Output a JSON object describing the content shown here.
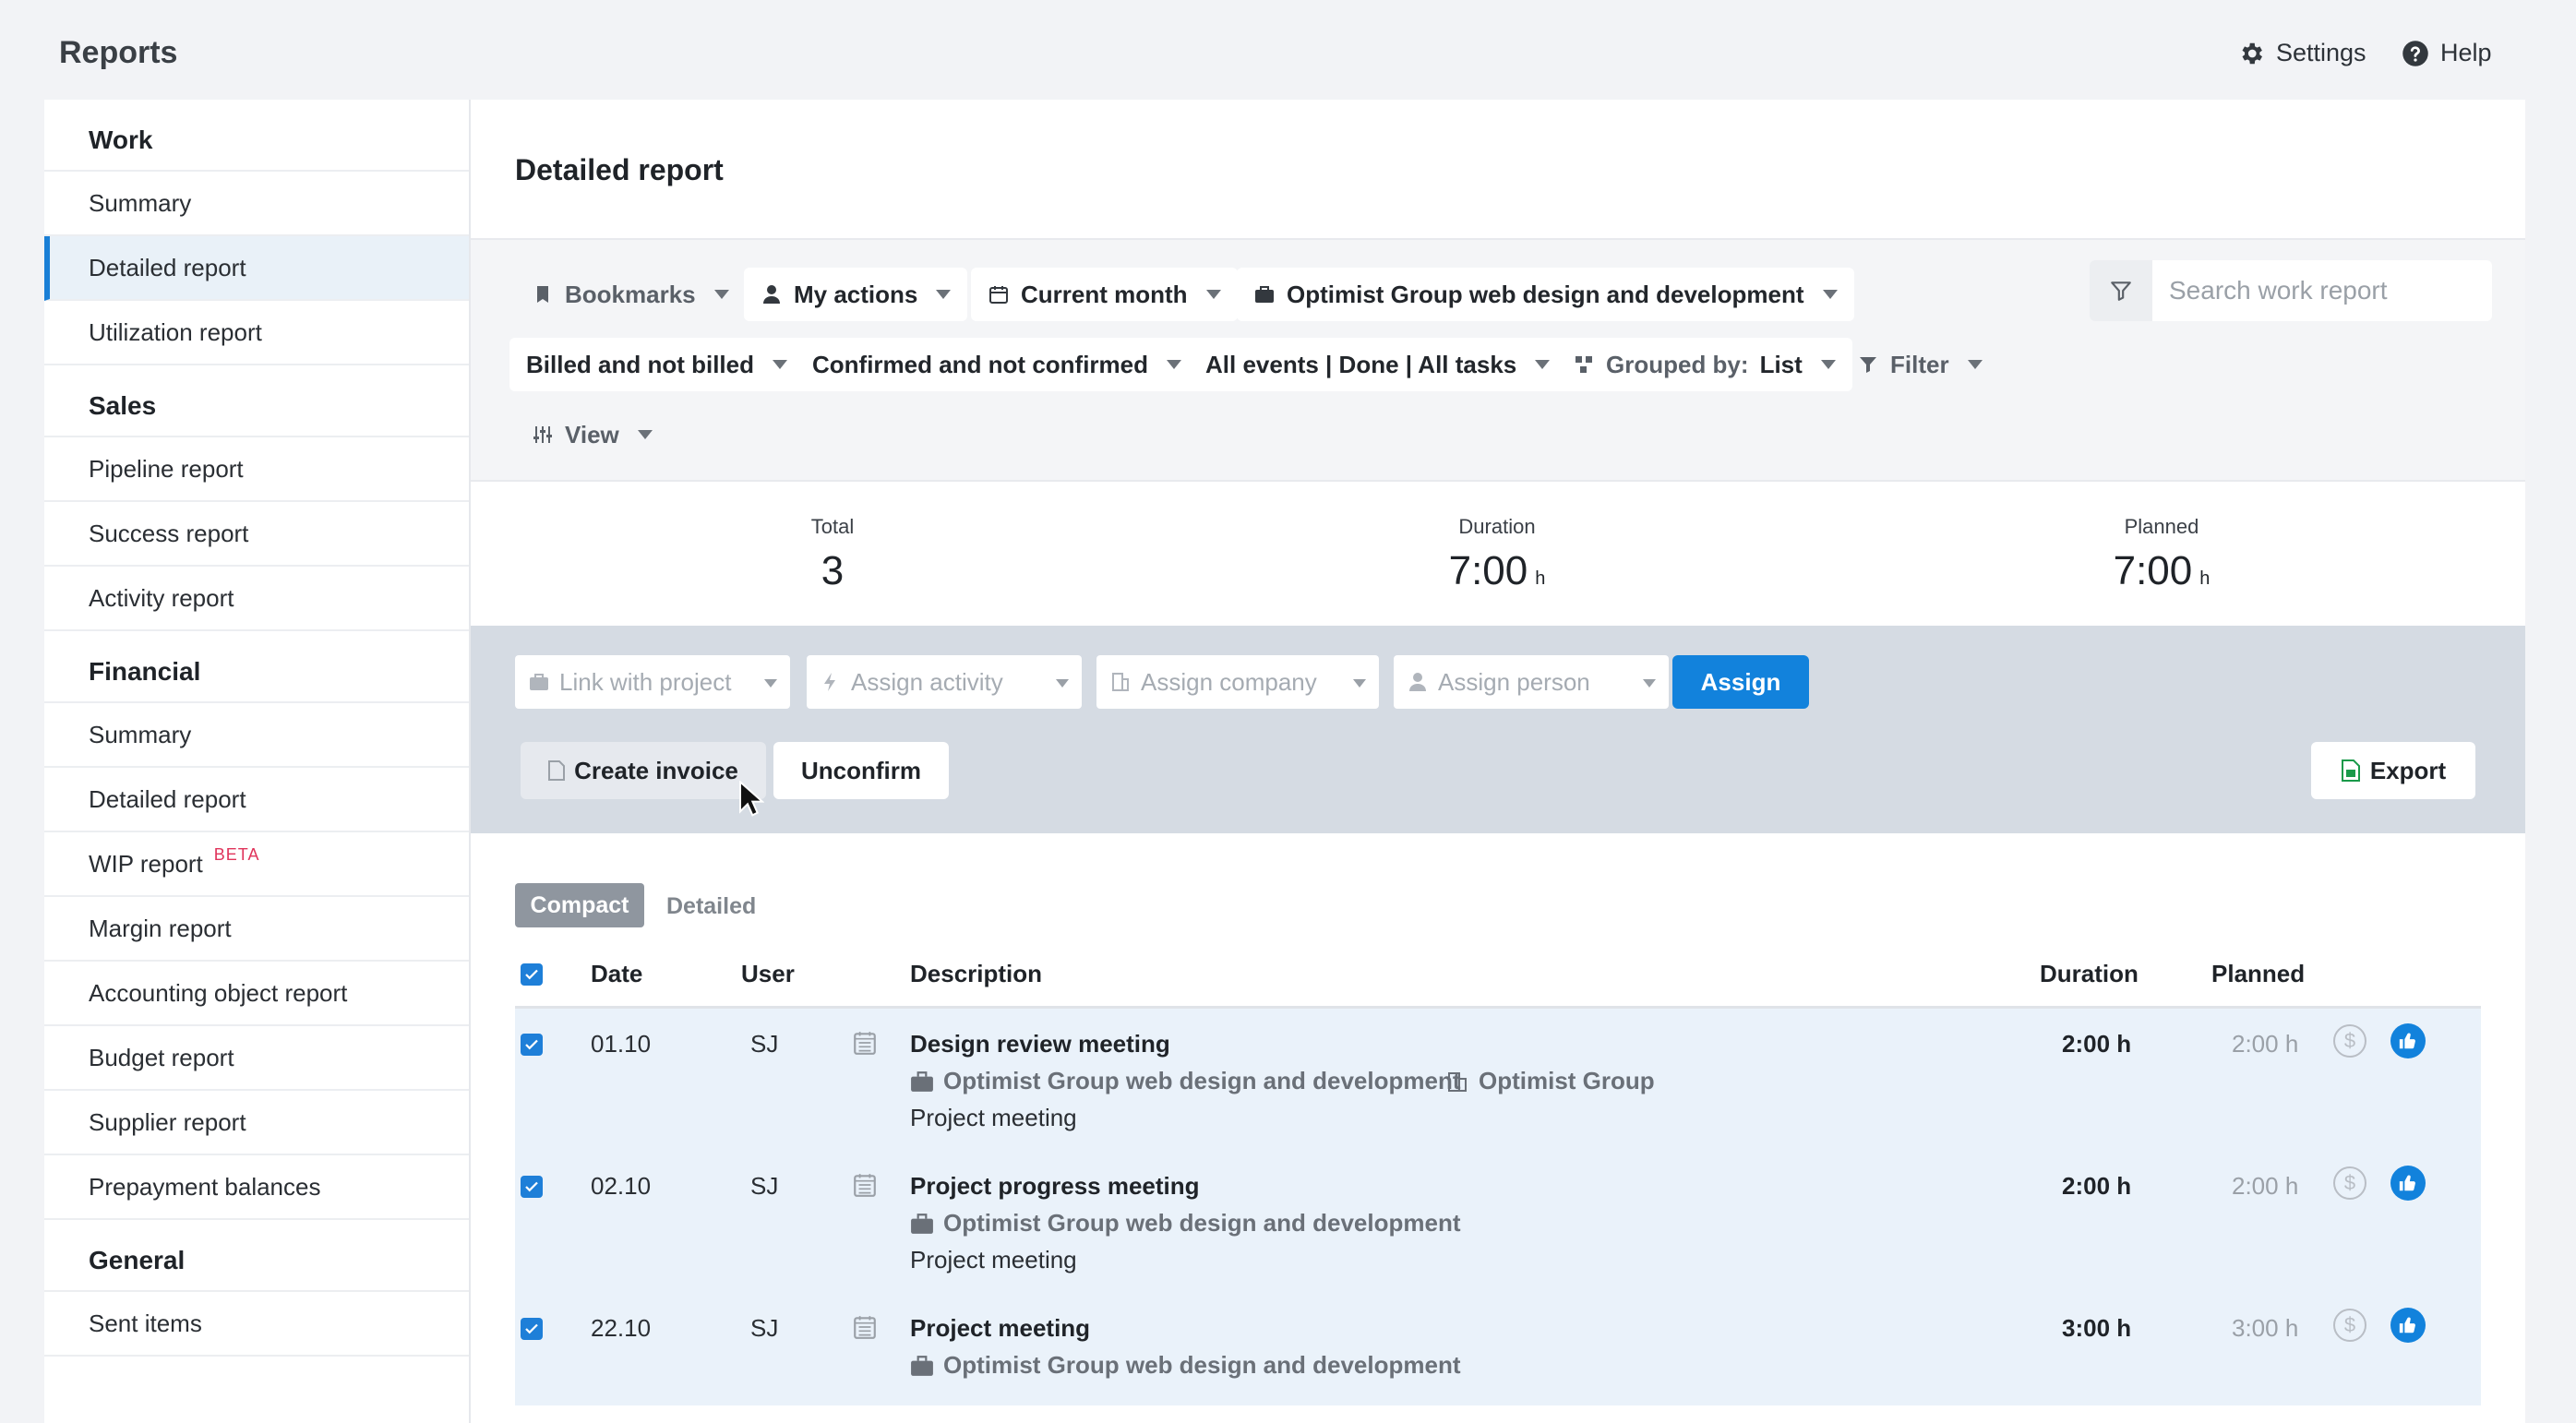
{
  "header": {
    "title": "Reports",
    "settings_label": "Settings",
    "help_label": "Help"
  },
  "sidebar": {
    "sections": [
      {
        "title": "Work",
        "items": [
          "Summary",
          "Detailed report",
          "Utilization report"
        ]
      },
      {
        "title": "Sales",
        "items": [
          "Pipeline report",
          "Success report",
          "Activity report"
        ]
      },
      {
        "title": "Financial",
        "items": [
          "Summary",
          "Detailed report",
          "WIP report",
          "Margin report",
          "Accounting object report",
          "Budget report",
          "Supplier report",
          "Prepayment balances"
        ]
      },
      {
        "title": "General",
        "items": [
          "Sent items"
        ]
      }
    ],
    "active_item": "Detailed report",
    "beta_badge": "BETA"
  },
  "main": {
    "title": "Detailed report",
    "filters": {
      "bookmarks": "Bookmarks",
      "my_actions": "My actions",
      "period": "Current month",
      "project": "Optimist Group web design and development",
      "billing": "Billed and not billed",
      "confirmation": "Confirmed and not confirmed",
      "events": "All events | Done | All tasks",
      "grouped_prefix": "Grouped by:",
      "grouped_value": "List",
      "filter": "Filter",
      "view": "View"
    },
    "search": {
      "placeholder": "Search work report"
    },
    "totals": {
      "total_label": "Total",
      "total_value": "3",
      "duration_label": "Duration",
      "duration_value": "7:00",
      "duration_unit": "h",
      "planned_label": "Planned",
      "planned_value": "7:00",
      "planned_unit": "h"
    },
    "actions": {
      "link_project": "Link with project",
      "assign_activity": "Assign activity",
      "assign_company": "Assign company",
      "assign_person": "Assign person",
      "assign": "Assign",
      "create_invoice": "Create invoice",
      "unconfirm": "Unconfirm",
      "export": "Export"
    },
    "tabs": {
      "compact": "Compact",
      "detailed": "Detailed"
    },
    "table": {
      "headers": {
        "date": "Date",
        "user": "User",
        "description": "Description",
        "duration": "Duration",
        "planned": "Planned"
      },
      "rows": [
        {
          "date": "01.10",
          "user": "SJ",
          "title": "Design review meeting",
          "project": "Optimist Group web design and development",
          "company": "Optimist Group",
          "activity": "Project meeting",
          "duration": "2:00 h",
          "planned": "2:00 h"
        },
        {
          "date": "02.10",
          "user": "SJ",
          "title": "Project progress meeting",
          "project": "Optimist Group web design and development",
          "company": "",
          "activity": "Project meeting",
          "duration": "2:00 h",
          "planned": "2:00 h"
        },
        {
          "date": "22.10",
          "user": "SJ",
          "title": "Project meeting",
          "project": "Optimist Group web design and development",
          "company": "",
          "activity": "",
          "duration": "3:00 h",
          "planned": "3:00 h"
        }
      ]
    }
  },
  "colors": {
    "accent": "#1282dc",
    "active_bg": "#e9f1f8",
    "action_bar": "#d5dbe3",
    "beta": "#e0345b"
  }
}
